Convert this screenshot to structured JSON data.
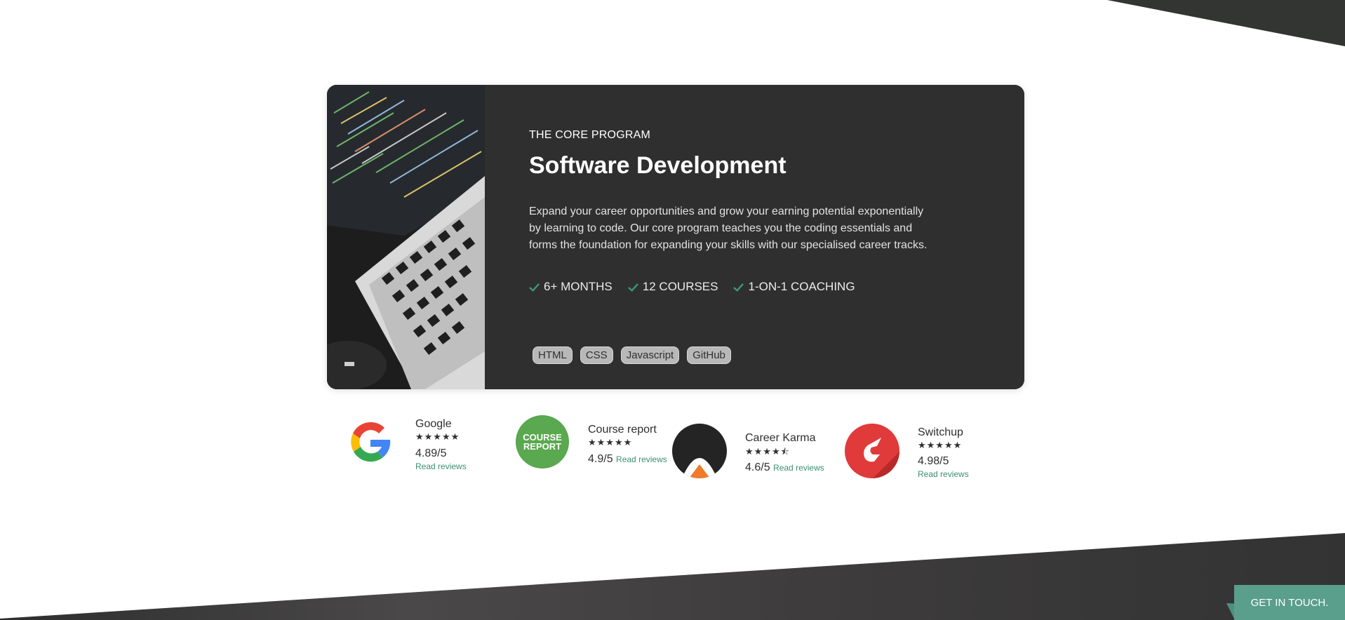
{
  "card": {
    "eyebrow": "THE CORE PROGRAM",
    "title": "Software Development",
    "description": "Expand your career opportunities and grow your earning potential exponentially by learning to code. Our core program teaches you the coding essentials and forms the foundation for expanding your skills with our specialised career tracks.",
    "features": [
      "6+ MONTHS",
      "12 COURSES",
      "1-ON-1 COACHING"
    ],
    "tags": [
      "HTML",
      "CSS",
      "Javascript",
      "GitHub"
    ]
  },
  "reviews": [
    {
      "name": "Google",
      "score": "4.89/5",
      "stars": "★★★★★",
      "link": "Read reviews"
    },
    {
      "name": "Course report",
      "score": "4.9/5",
      "stars": "★★★★★",
      "link": "Read reviews",
      "logo_text": "COURSE REPORT"
    },
    {
      "name": "Career Karma",
      "score": "4.6/5",
      "stars": "★★★★⯪",
      "link": "Read reviews"
    },
    {
      "name": "Switchup",
      "score": "4.98/5",
      "stars": "★★★★★",
      "link": "Read reviews"
    }
  ],
  "cta": {
    "label": "GET IN TOUCH."
  },
  "colors": {
    "accent": "#3b8f74",
    "card": "#2f2f2f",
    "cta": "#5a9e8c",
    "dark_band": "#333333"
  }
}
